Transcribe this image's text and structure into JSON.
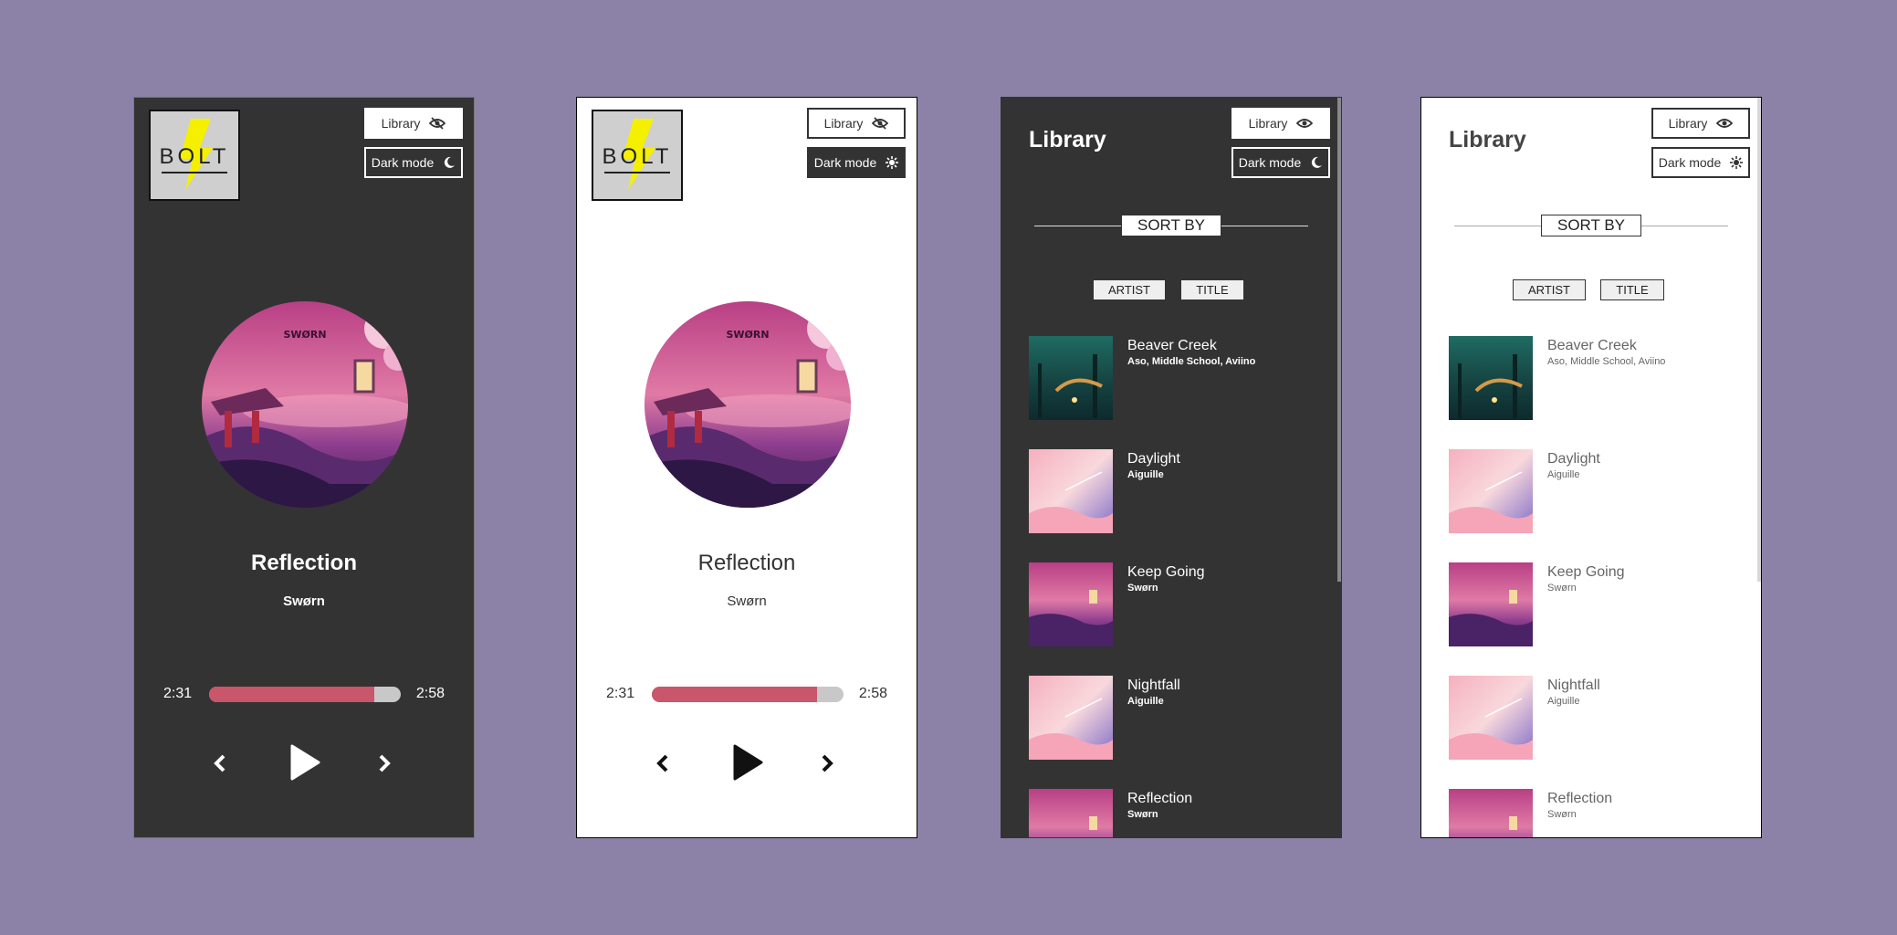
{
  "logo": {
    "text": "BOLT"
  },
  "buttons": {
    "library": "Library",
    "dark_mode": "Dark mode"
  },
  "player": {
    "title": "Reflection",
    "artist": "Swørn",
    "album_art_text": "SWØRN",
    "current_time": "2:31",
    "total_time": "2:58",
    "progress": 0.86
  },
  "library": {
    "title": "Library",
    "sort_by": "SORT BY",
    "sort_artist": "ARTIST",
    "sort_title": "TITLE",
    "tracks": [
      {
        "name": "Beaver Creek",
        "artist": "Aso, Middle School, Aviino"
      },
      {
        "name": "Daylight",
        "artist": "Aiguille"
      },
      {
        "name": "Keep Going",
        "artist": "Swørn"
      },
      {
        "name": "Nightfall",
        "artist": "Aiguille"
      },
      {
        "name": "Reflection",
        "artist": "Swørn"
      }
    ]
  },
  "colors": {
    "background": "#8c82a8",
    "dark_panel": "#333333",
    "progress_fill": "#c9566a",
    "progress_track": "#c8c8c8",
    "logo_bolt": "#f4f000"
  },
  "icons": {
    "library_hidden": "eye-slash-icon",
    "library_shown": "eye-icon",
    "dark_mode": "moon-icon",
    "light_mode": "sun-icon",
    "prev": "chevron-left-icon",
    "play": "play-icon",
    "next": "chevron-right-icon"
  }
}
